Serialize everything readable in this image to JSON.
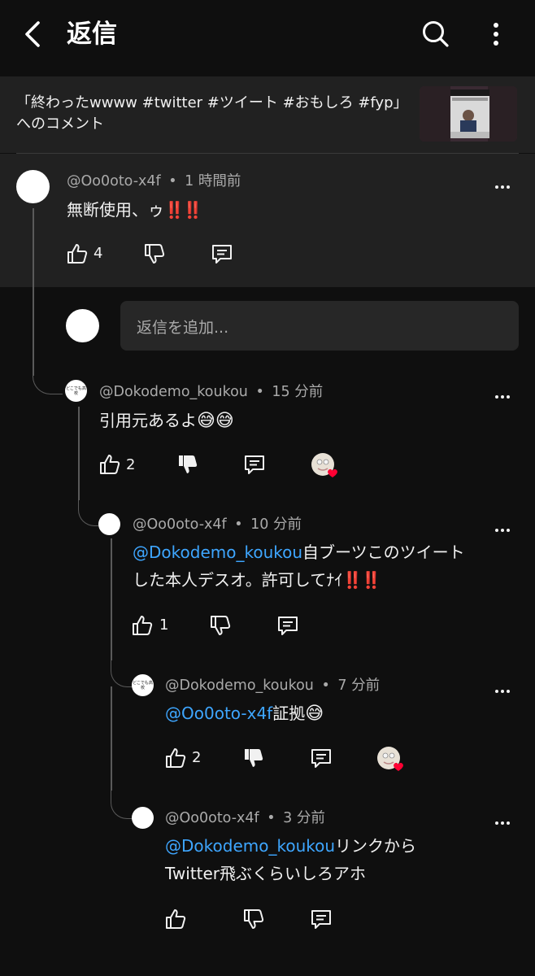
{
  "header": {
    "title": "返信"
  },
  "video": {
    "title_line1": "「終わったwwww #twitter #ツイート #おもしろ #fyp」",
    "title_line2": "へのコメント"
  },
  "reply_input": {
    "placeholder": "返信を追加..."
  },
  "comments": [
    {
      "author": "@Oo0oto-x4f",
      "time": "1 時間前",
      "text": "無断使用、ゥ",
      "emoji": "‼️‼️",
      "likes": "4"
    },
    {
      "author": "@Dokodemo_koukou",
      "time": "15 分前",
      "text": "引用元あるよ",
      "emoji": "😅😅",
      "likes": "2",
      "avatar_text": "どこでも高校"
    },
    {
      "author": "@Oo0oto-x4f",
      "time": "10 分前",
      "mention": "@Dokodemo_koukou",
      "text_line1": "自ブーツこのツイート",
      "text_line2": "した本人デスオ。許可してﾅｲ",
      "emoji": "‼️‼️",
      "likes": "1"
    },
    {
      "author": "@Dokodemo_koukou",
      "time": "7 分前",
      "mention": "@Oo0oto-x4f",
      "text": "証拠",
      "emoji": "😅",
      "likes": "2",
      "avatar_text": "どこでも高校"
    },
    {
      "author": "@Oo0oto-x4f",
      "time": "3 分前",
      "mention": "@Dokodemo_koukou",
      "text_line1": "リンクから",
      "text_line2": "Twitter飛ぶくらいしろアホ",
      "likes": ""
    }
  ],
  "separator": "•",
  "icons": {
    "back": "chevron-left-icon",
    "search": "search-icon",
    "more": "more-vertical-icon",
    "like": "thumbs-up-icon",
    "dislike": "thumbs-down-icon",
    "reply": "comment-icon",
    "creator_heart": "creator-heart-icon"
  },
  "colors": {
    "background": "#0f0f0f",
    "highlight": "#212121",
    "mention": "#3ea6ff",
    "heart": "#ff0033"
  }
}
